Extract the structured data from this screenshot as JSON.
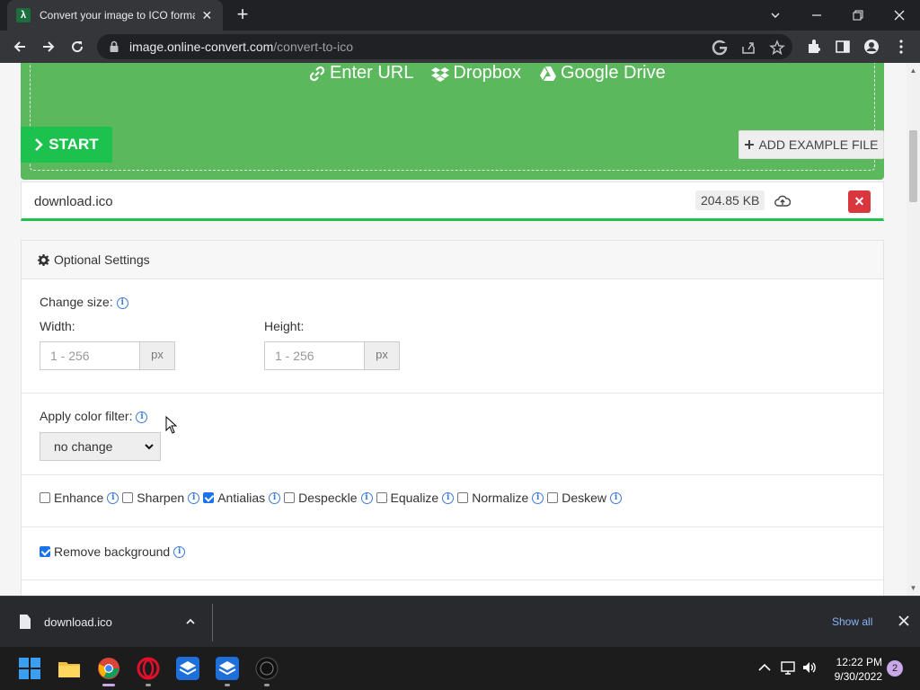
{
  "browser": {
    "tab_title": "Convert your image to ICO format",
    "tab_close": "✕",
    "new_tab": "+",
    "url_host": "image.online-convert.com",
    "url_path": "/convert-to-ico"
  },
  "upload": {
    "enter_url": "Enter URL",
    "dropbox": "Dropbox",
    "google_drive": "Google Drive"
  },
  "actions": {
    "start": "START",
    "add_example": "ADD EXAMPLE FILE"
  },
  "file": {
    "name": "download.ico",
    "size": "204.85 KB",
    "remove": "✕"
  },
  "settings": {
    "title": "Optional Settings",
    "change_size_label": "Change size:",
    "width_label": "Width:",
    "width_placeholder": "1 - 256",
    "height_label": "Height:",
    "height_placeholder": "1 - 256",
    "unit": "px",
    "color_filter_label": "Apply color filter:",
    "color_filter_value": "no change",
    "checkboxes": [
      {
        "label": "Enhance",
        "checked": false
      },
      {
        "label": "Sharpen",
        "checked": false
      },
      {
        "label": "Antialias",
        "checked": true
      },
      {
        "label": "Despeckle",
        "checked": false
      },
      {
        "label": "Equalize",
        "checked": false
      },
      {
        "label": "Normalize",
        "checked": false
      },
      {
        "label": "Deskew",
        "checked": false
      }
    ],
    "remove_background_label": "Remove background",
    "remove_background_checked": true
  },
  "download_bar": {
    "file_name": "download.ico",
    "show_all": "Show all"
  },
  "taskbar": {
    "time": "12:22 PM",
    "date": "9/30/2022",
    "notifications": "2"
  },
  "colors": {
    "brand_green": "#1dc24e",
    "upload_green": "#5cb85c",
    "remove_red": "#d9363e",
    "info_blue": "#3a7bd5"
  }
}
